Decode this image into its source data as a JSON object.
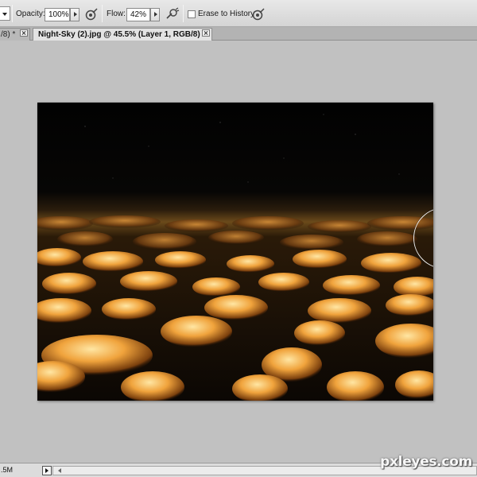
{
  "options_bar": {
    "opacity_label": "Opacity:",
    "opacity_value": "100%",
    "flow_label": "Flow:",
    "flow_value": "42%",
    "erase_to_history_label": "Erase to History",
    "erase_to_history_checked": false,
    "icons": [
      "tool-preset-dropdown-icon",
      "pressure-opacity-icon",
      "airbrush-icon",
      "pressure-size-icon"
    ]
  },
  "tabs": {
    "inactive_label": "/8) *",
    "active_label": "Night-Sky (2).jpg @ 45.5% (Layer 1, RGB/8) *"
  },
  "status_bar": {
    "doc_size": ".5M"
  },
  "watermark": "pxleyes.com",
  "colors": {
    "ui_background": "#c1c1c1",
    "cloud_highlight": "#ffd27a",
    "cloud_mid": "#c87a22",
    "sky": "#050404"
  }
}
